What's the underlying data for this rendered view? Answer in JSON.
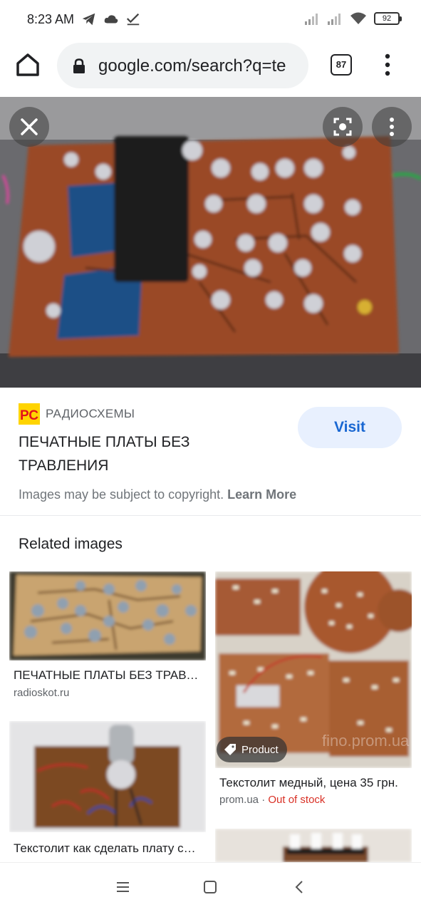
{
  "status_bar": {
    "time": "8:23 AM",
    "battery": "92",
    "icons_left": [
      "telegram-icon",
      "cloud-icon",
      "check-icon"
    ],
    "icons_right": [
      "signal-icon",
      "signal-icon",
      "wifi-icon",
      "battery-icon"
    ]
  },
  "toolbar": {
    "url": "google.com/search?q=te",
    "tab_count": "87"
  },
  "viewer": {
    "icons": [
      "close-icon",
      "lens-icon",
      "more-vert-icon"
    ]
  },
  "result": {
    "source_name": "РАДИОСХЕМЫ",
    "source_logo_text": "РС",
    "title": "ПЕЧАТНЫЕ ПЛАТЫ БЕЗ ТРАВЛЕНИЯ",
    "visit_label": "Visit",
    "copyright_text": "Images may be subject to copyright.",
    "learn_more_label": "Learn More"
  },
  "related": {
    "heading": "Related images",
    "items": [
      {
        "title": "ПЕЧАТНЫЕ ПЛАТЫ БЕЗ ТРАВЛЕНИЯ",
        "domain": "radioskot.ru"
      },
      {
        "title": "Текстолит медный, цена 35 грн.",
        "domain": "prom.ua",
        "status": "Out of stock",
        "badge": "Product",
        "watermark": "fino.prom.ua"
      },
      {
        "title": "Текстолит как сделать плату своими руками",
        "domain": ""
      }
    ]
  },
  "nav_bar": {
    "icons": [
      "menu-icon",
      "home-square-icon",
      "back-icon"
    ]
  }
}
